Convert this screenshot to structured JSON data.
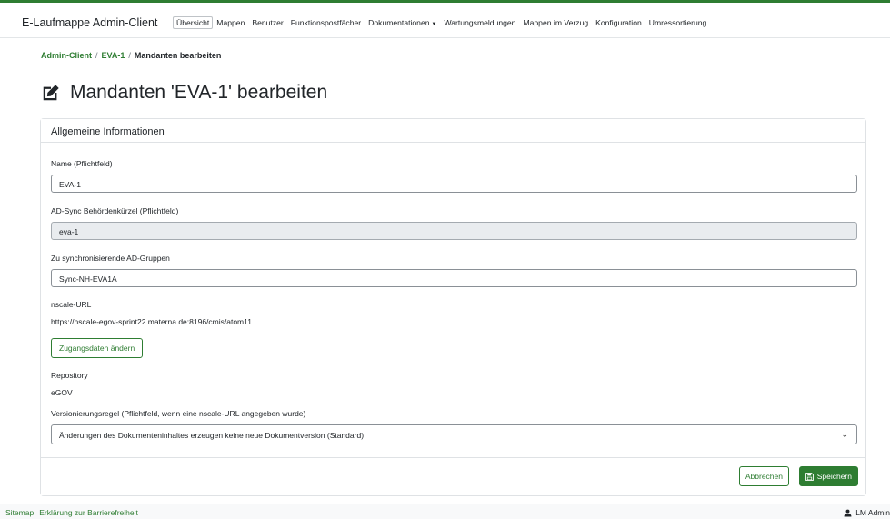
{
  "header": {
    "brand": "E-Laufmappe Admin-Client",
    "nav": [
      {
        "label": "Übersicht",
        "active": true
      },
      {
        "label": "Mappen"
      },
      {
        "label": "Benutzer"
      },
      {
        "label": "Funktionspostfächer"
      },
      {
        "label": "Dokumentationen",
        "dropdown": true
      },
      {
        "label": "Wartungsmeldungen"
      },
      {
        "label": "Mappen im Verzug"
      },
      {
        "label": "Konfiguration"
      },
      {
        "label": "Umressortierung"
      }
    ]
  },
  "breadcrumb": {
    "root": "Admin-Client",
    "parent": "EVA-1",
    "current": "Mandanten bearbeiten",
    "separator": "/"
  },
  "page": {
    "title": "Mandanten 'EVA-1' bearbeiten",
    "title_icon": "edit-icon"
  },
  "card": {
    "header": "Allgemeine Informationen",
    "name_label": "Name (Pflichtfeld)",
    "name_value": "EVA-1",
    "adsync_label": "AD-Sync Behördenkürzel (Pflichtfeld)",
    "adsync_value": "eva-1",
    "groups_label": "Zu synchronisierende AD-Gruppen",
    "groups_value": "Sync-NH-EVA1A",
    "nscale_label": "nscale-URL",
    "nscale_value": "https://nscale-egov-sprint22.materna.de:8196/cmis/atom11",
    "change_credentials_button": "Zugangsdaten ändern",
    "repository_label": "Repository",
    "repository_value": "eGOV",
    "versioning_label": "Versionierungsregel (Pflichtfeld, wenn eine nscale-URL angegeben wurde)",
    "versioning_value": "Änderungen des Dokumenteninhaltes erzeugen keine neue Dokumentversion (Standard)",
    "cancel_button": "Abbrechen",
    "save_button": "Speichern"
  },
  "footer": {
    "sitemap": "Sitemap",
    "accessibility": "Erklärung zur Barrierefreiheit",
    "user": "LM Admin"
  },
  "colors": {
    "accent": "#2e7d32"
  }
}
